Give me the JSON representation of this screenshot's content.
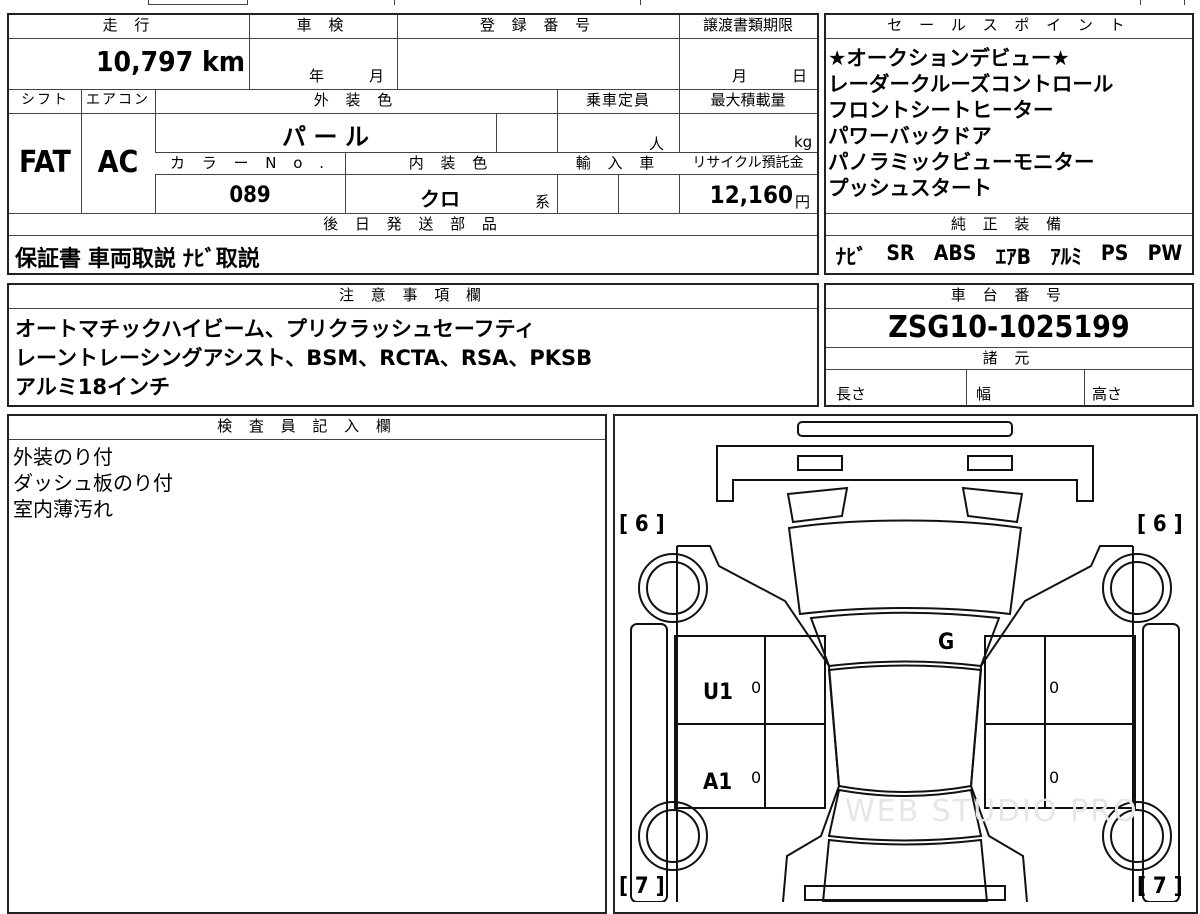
{
  "top": {
    "mileage_header": "走 行",
    "mileage_value": "10,797 km",
    "inspection_header": "車 検",
    "inspection_year_unit": "年",
    "inspection_month_unit": "月",
    "registration_header": "登 録 番 号",
    "transfer_header": "譲渡書類期限",
    "transfer_month_unit": "月",
    "transfer_day_unit": "日",
    "shift_header": "シフト",
    "shift_value": "FAT",
    "aircon_header": "エアコン",
    "aircon_value": "AC",
    "exterior_header": "外 装 色",
    "exterior_value": "パ ー ル",
    "capacity_header": "乗車定員",
    "capacity_unit": "人",
    "maxload_header": "最大積載量",
    "maxload_unit": "kg",
    "color_no_header": "カ ラ ー N o .",
    "color_no_value": "089",
    "interior_header": "内 装 色",
    "interior_value": "クロ",
    "interior_suffix": "系",
    "import_header": "輸 入 車",
    "recycle_header": "リサイクル預託金",
    "recycle_value": "12,160",
    "recycle_unit": "円",
    "later_header": "後 日 発 送 部 品",
    "later_value": "保証書 車両取説 ﾅﾋﾞ取説"
  },
  "sales": {
    "header": "セ ー ル ス ポ イ ン ト",
    "points": [
      "★オークションデビュー★",
      "レーダークルーズコントロール",
      "フロントシートヒーター",
      "パワーバックドア",
      "パノラミックビューモニター",
      "プッシュスタート"
    ],
    "equipment_header": "純 正 装 備",
    "equipment": [
      "ﾅﾋﾞ",
      "SR",
      "ABS",
      "ｴｱB",
      "ｱﾙﾐ",
      "PS",
      "PW"
    ]
  },
  "notes": {
    "header": "注 意 事 項 欄",
    "lines": [
      "オートマチックハイビーム、プリクラッシュセーフティ",
      "レーントレーシングアシスト、BSM、RCTA、RSA、PKSB",
      "アルミ18インチ"
    ]
  },
  "chassis": {
    "header": "車 台 番 号",
    "value": "ZSG10-1025199",
    "specs_header": "諸 元",
    "length_label": "長さ",
    "width_label": "幅",
    "height_label": "高さ"
  },
  "inspector": {
    "header": "検 査 員 記 入 欄",
    "lines": [
      "外装のり付",
      "ダッシュ板のり付",
      "室内薄汚れ"
    ]
  },
  "diagram": {
    "front_left_tire": "[ 6 ]",
    "front_right_tire": "[ 6 ]",
    "rear_left_tire": "[ 7 ]",
    "rear_right_tire": "[ 7 ]",
    "windshield_mark": "G",
    "front_left_door_mark": "U1",
    "rear_left_door_mark": "A1",
    "door_small_fl": "0",
    "door_small_rl": "0",
    "door_small_fr": "0",
    "door_small_rr": "0",
    "watermark": "WEB STUDIO PRO"
  }
}
